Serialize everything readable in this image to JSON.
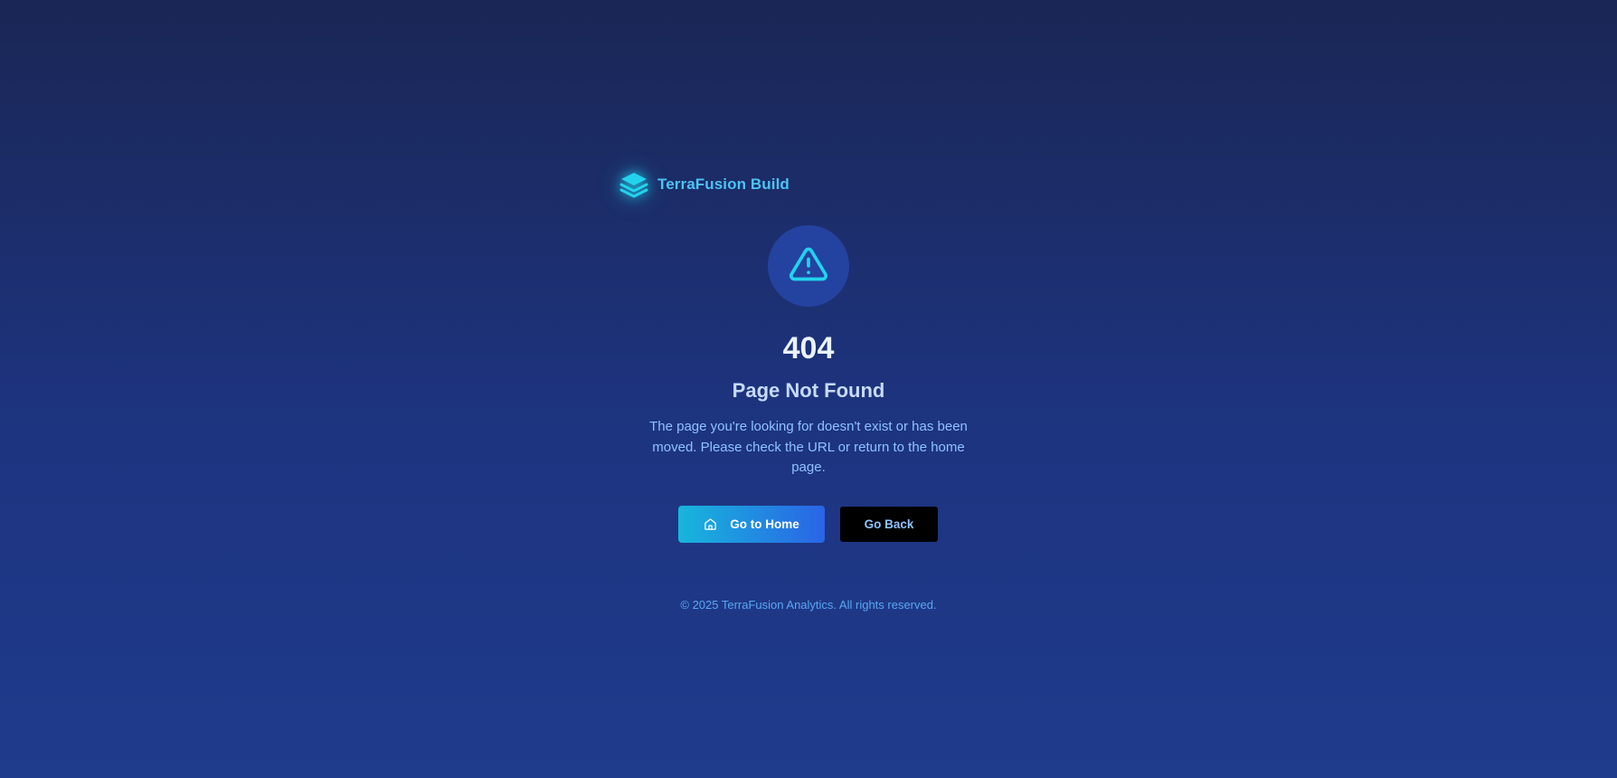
{
  "brand": {
    "name": "TerraFusion Build",
    "icon": "layers-icon",
    "color": "#4cc3f5"
  },
  "error": {
    "icon": "warning-triangle-icon",
    "code": "404",
    "title": "Page Not Found",
    "description": "The page you're looking for doesn't exist or has been moved. Please check the URL or return to the home page."
  },
  "actions": {
    "home_label": "Go to Home",
    "home_icon": "home-icon",
    "back_label": "Go Back"
  },
  "footer": {
    "text": "© 2025 TerraFusion Analytics. All rights reserved."
  },
  "colors": {
    "accent": "#22d3ee",
    "button_gradient_start": "#17b6dc",
    "button_gradient_end": "#2a64e6",
    "background_top": "#1a2655",
    "background_bottom": "#1f3b8c"
  }
}
